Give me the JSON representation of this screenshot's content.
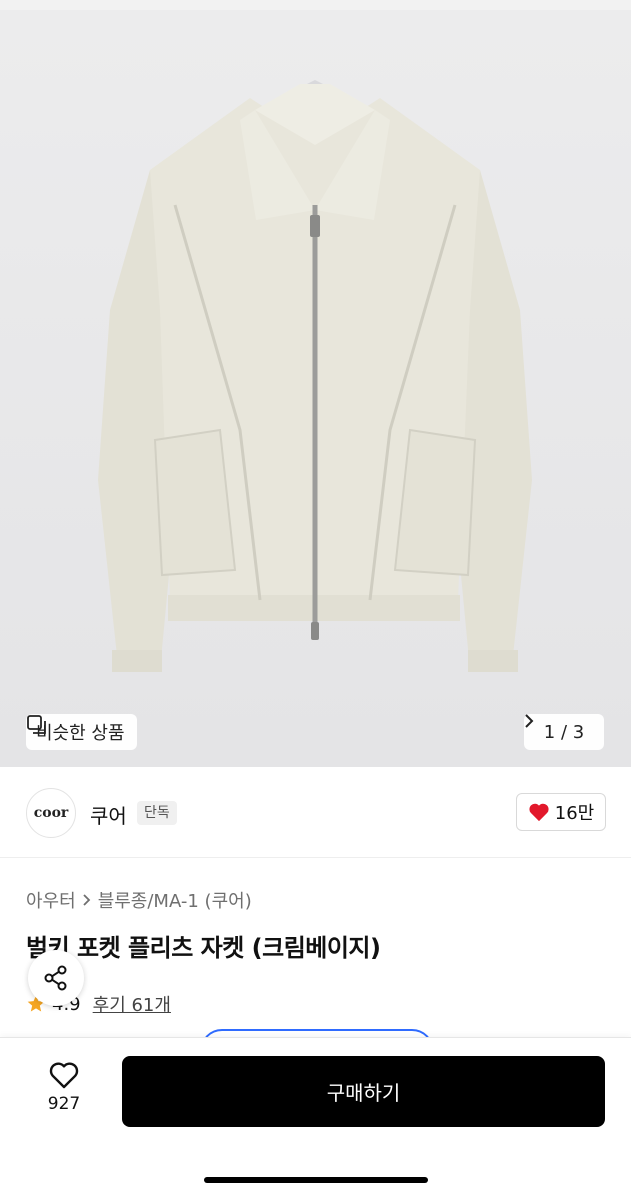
{
  "hero": {
    "similar_label": "비슷한 상품",
    "pager": "1 / 3"
  },
  "brand": {
    "logo_text": "coor",
    "name": "쿠어",
    "badge": "단독",
    "likes": "16만"
  },
  "product": {
    "breadcrumb": [
      "아우터",
      "블루종/MA-1 (쿠어)"
    ],
    "title": "벌키 포켓 플리츠 자켓 (크림베이지)",
    "rating": "4.9",
    "reviews": "후기 61개"
  },
  "footer": {
    "wish_count": "927",
    "buy_label": "구매하기"
  },
  "colors": {
    "heart_red": "#e2182b",
    "star_yellow": "#f5a623",
    "buy_bg": "#000000",
    "jacket": "#e7e5da"
  },
  "icons": [
    "similar-icon",
    "chevron-right-icon",
    "heart-icon",
    "share-icon",
    "star-icon",
    "heart-outline-icon"
  ]
}
